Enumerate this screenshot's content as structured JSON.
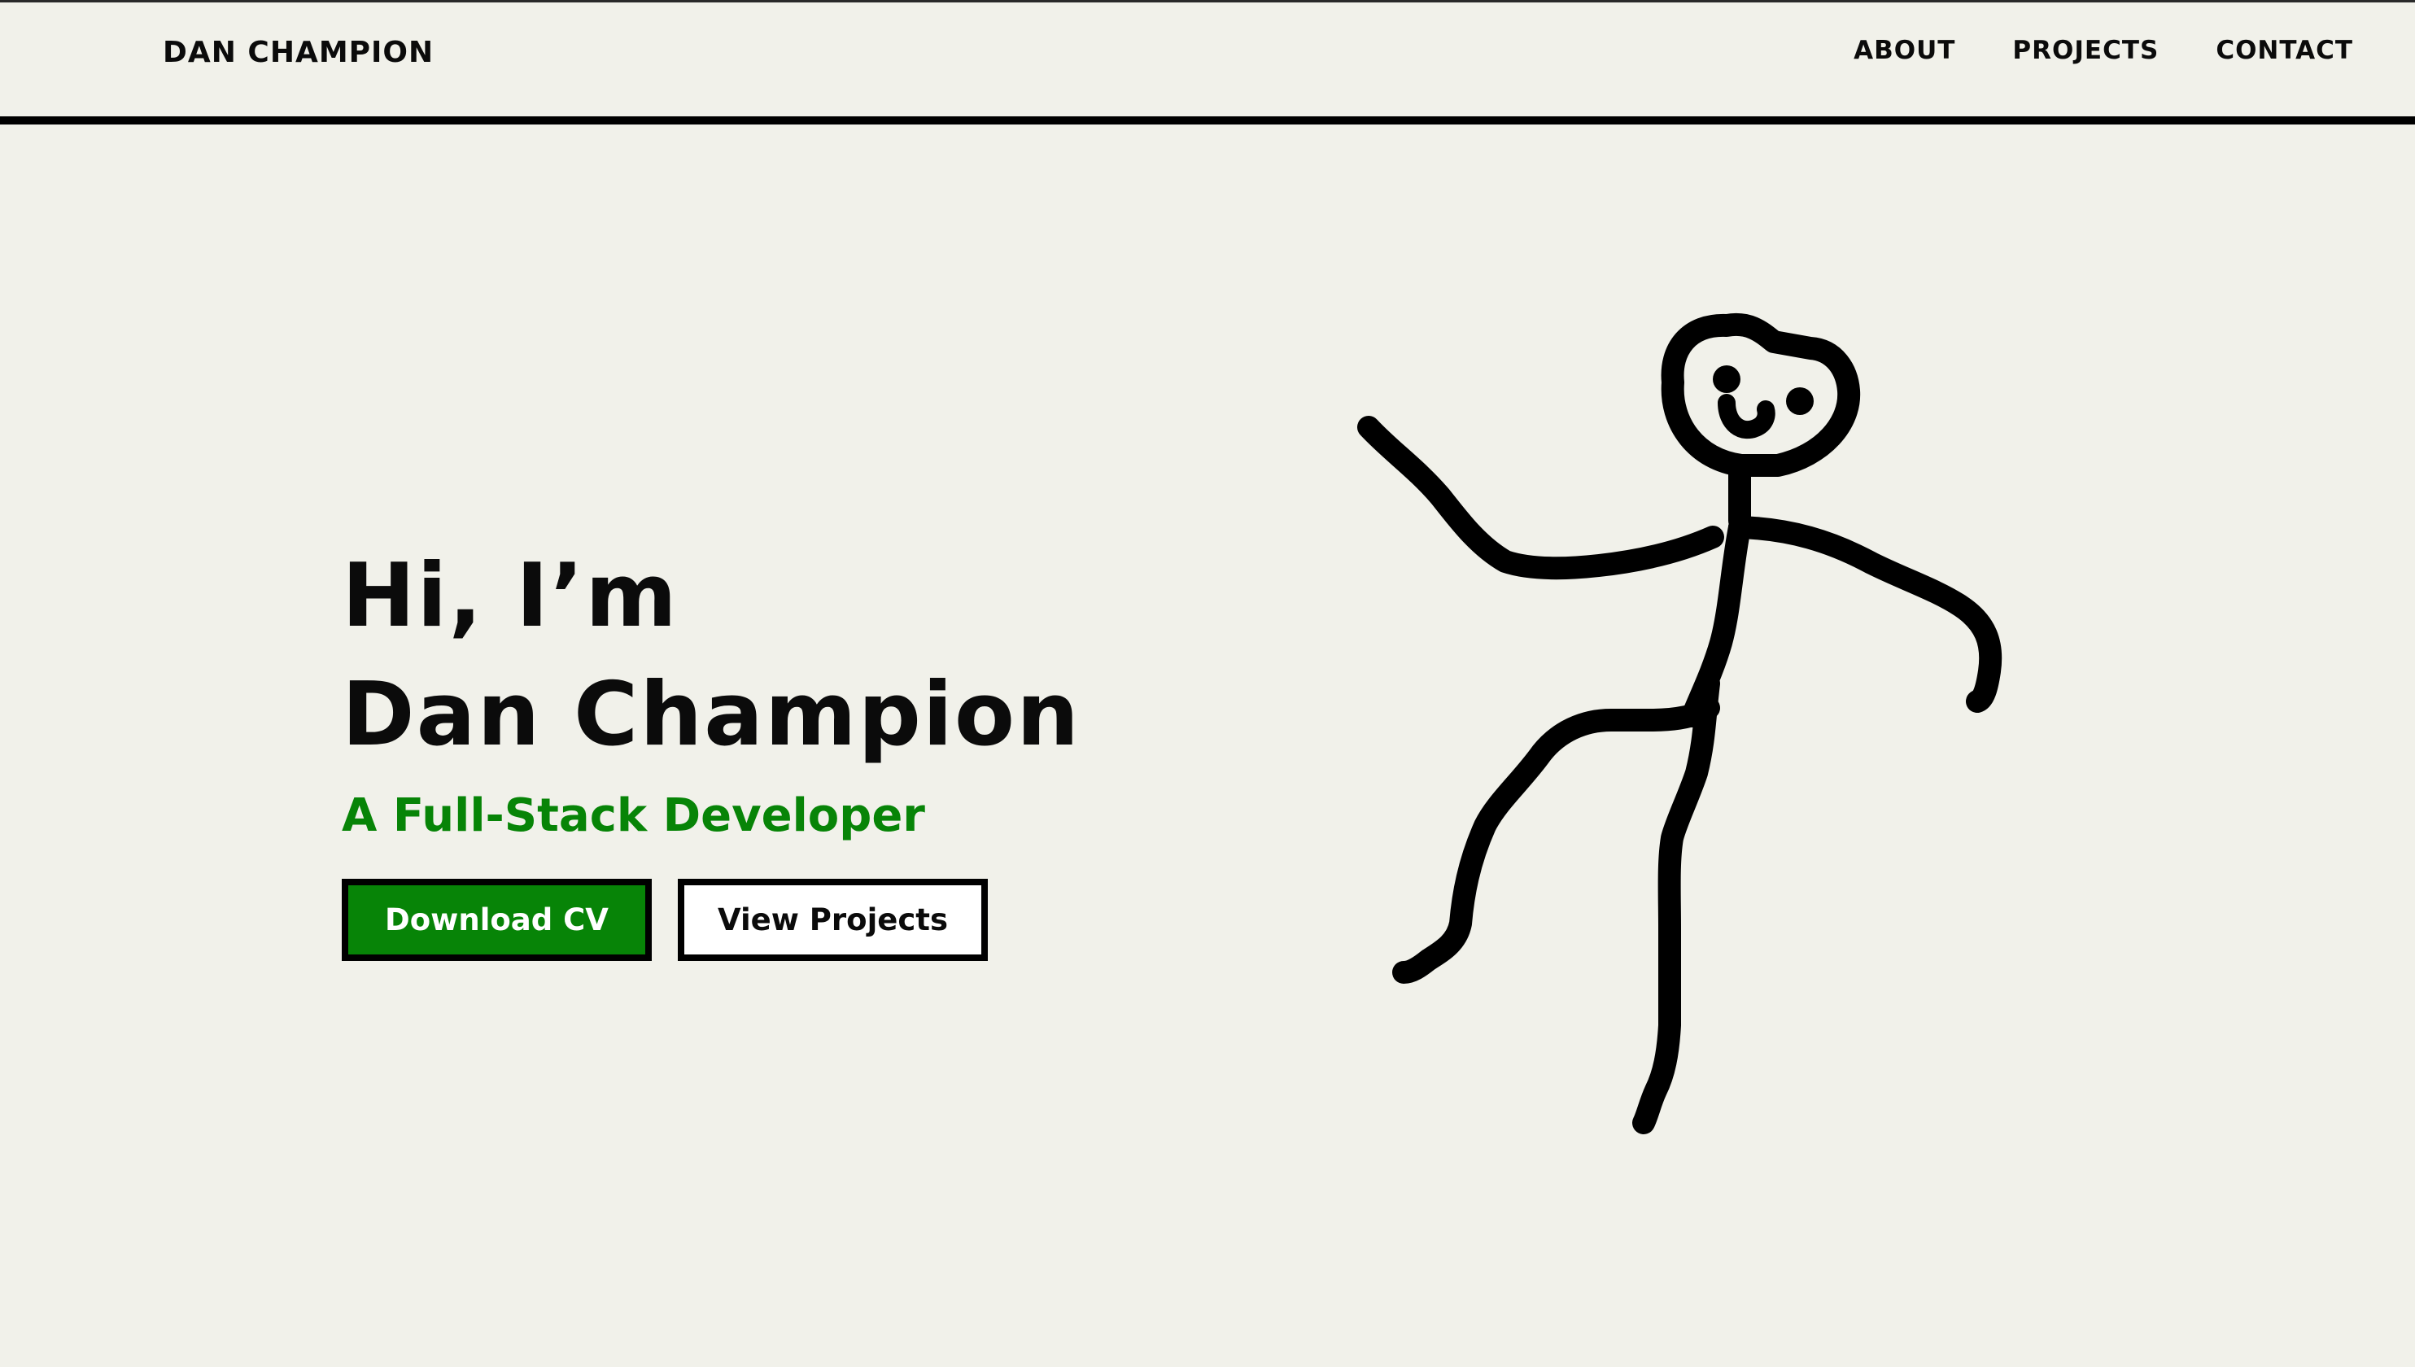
{
  "header": {
    "brand": "DAN CHAMPION",
    "nav": [
      "ABOUT",
      "PROJECTS",
      "CONTACT"
    ]
  },
  "hero": {
    "greeting": "Hi, I’m",
    "name": "Dan Champion",
    "subtitle": "A Full-Stack Developer",
    "buttons": {
      "download": "Download CV",
      "projects": "View Projects"
    }
  },
  "illustration": {
    "icon": "stick-figure-drawing"
  },
  "colors": {
    "background": "#f1f1ea",
    "accent_green": "#078407",
    "ink": "#000000"
  }
}
